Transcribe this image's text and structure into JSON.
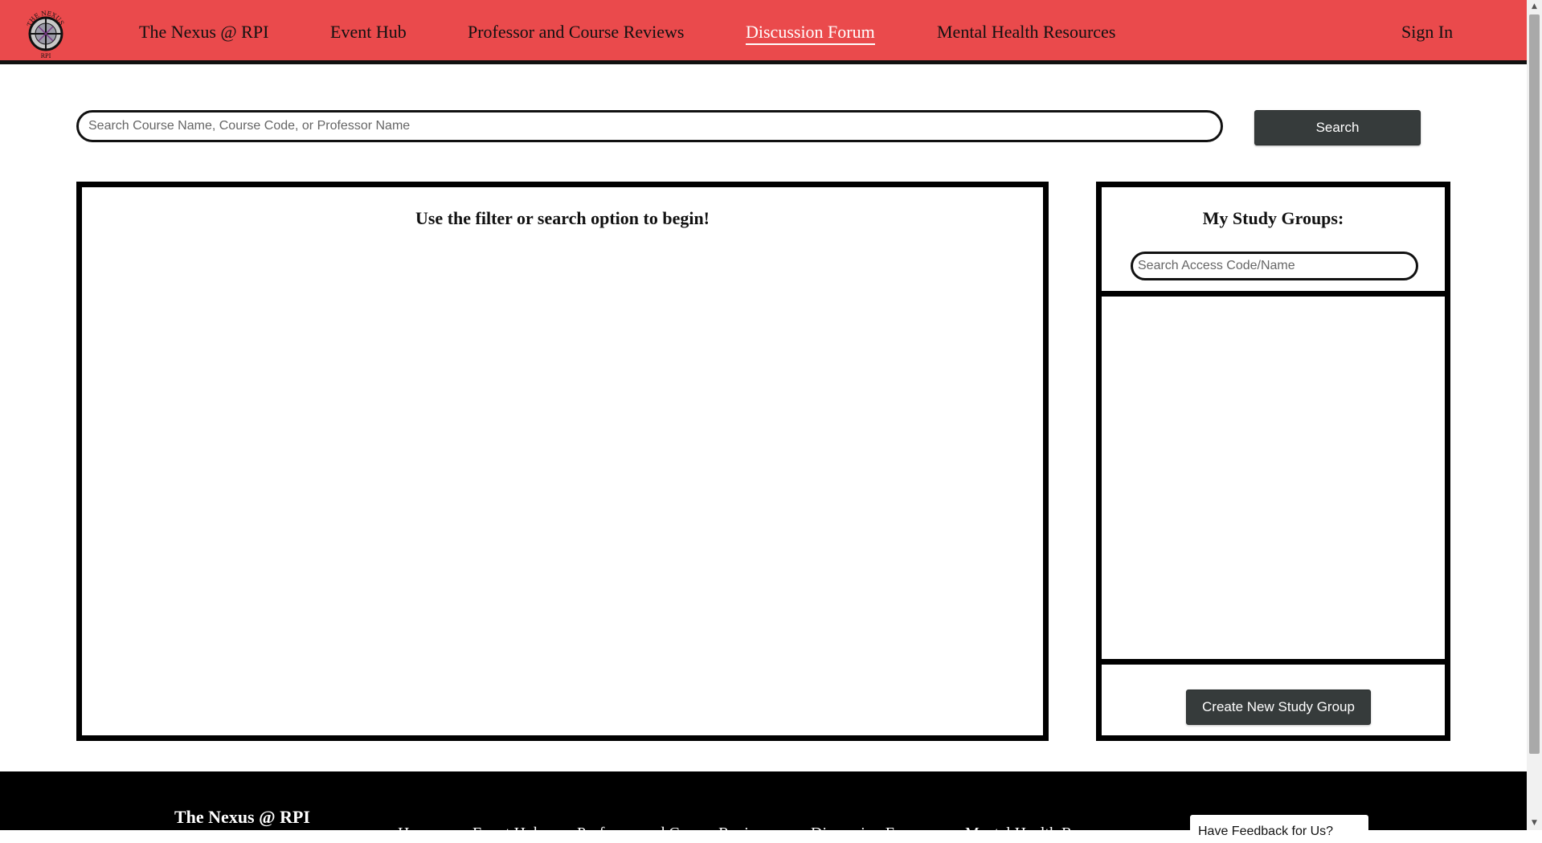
{
  "nav": {
    "logo_text_top": "THE NEXUS",
    "logo_text_bottom": "RPI",
    "items": [
      {
        "label": "The Nexus @ RPI"
      },
      {
        "label": "Event Hub"
      },
      {
        "label": "Professor and Course Reviews"
      },
      {
        "label": "Discussion Forum"
      },
      {
        "label": "Mental Health Resources"
      }
    ],
    "active": "Discussion Forum",
    "sign_in": "Sign In"
  },
  "search": {
    "placeholder": "Search Course Name, Course Code, or Professor Name",
    "value": "",
    "button_label": "Search"
  },
  "main": {
    "message": "Use the filter or search option to begin!"
  },
  "study_groups": {
    "title": "My Study Groups:",
    "search_placeholder": "Search Access Code/Name",
    "create_label": "Create New Study Group"
  },
  "footer": {
    "brand": "The Nexus @ RPI",
    "links": [
      {
        "label": "Home"
      },
      {
        "label": "Event Hub"
      },
      {
        "label": "Professor and Course Reviews"
      },
      {
        "label": "Discussion Forum"
      },
      {
        "label": "Mental Health Resources"
      }
    ],
    "feedback_label": "Have Feedback for Us?"
  },
  "colors": {
    "nav_bg": "#ea4a4c",
    "button_bg": "#363b3b",
    "footer_bg": "#000000"
  }
}
